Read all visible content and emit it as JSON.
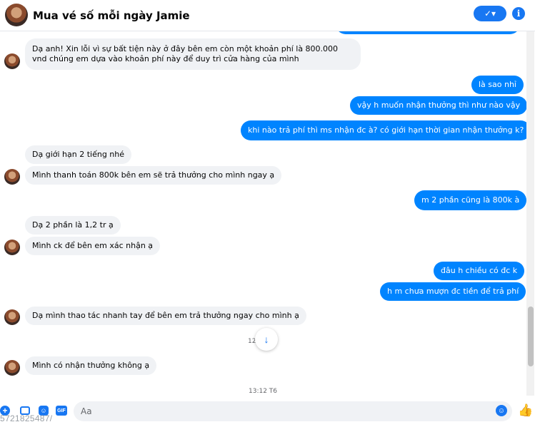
{
  "header": {
    "title": "Mua vé số mỗi ngày Jamie",
    "check_label": "✓▾",
    "info_label": "i"
  },
  "messages": [
    {
      "dir": "in",
      "text": "Dạ anh! Xin lỗi vì sự bất tiện này ở đây bên em còn một khoản phí là 800.000 vnd chúng em dựa vào khoản phí này để duy trì cửa hàng của mình"
    },
    {
      "dir": "out",
      "text": "là sao nhỉ"
    },
    {
      "dir": "out",
      "text": "vậy h muốn nhận thưởng thì như nào vậy"
    },
    {
      "dir": "out",
      "text": "khi nào trả phí thì ms nhận đc à? có giới hạn thời gian nhận thưởng k?"
    },
    {
      "dir": "in",
      "text": "Dạ giới hạn 2 tiếng nhé"
    },
    {
      "dir": "in",
      "text": "Mình thanh toán 800k bên em sẽ trả thưởng cho mình ngay ạ"
    },
    {
      "dir": "out",
      "text": "m 2 phần cũng là 800k à"
    },
    {
      "dir": "in",
      "text": "Dạ 2 phần là 1,2 tr ạ"
    },
    {
      "dir": "in",
      "text": "Mình ck để bên em xác nhận ạ"
    },
    {
      "dir": "out",
      "text": "đâu h chiều có đc k"
    },
    {
      "dir": "out",
      "text": "h m chưa mượn đc tiền để trả phí"
    },
    {
      "dir": "in",
      "text": "Dạ mình thao tác nhanh tay để bên em trả thưởng ngay cho mình ạ"
    },
    {
      "dir": "in",
      "text": "Mình có nhận thưởng không ạ"
    }
  ],
  "timestamps": [
    "12:50 T6",
    "13:12 T6"
  ],
  "composer": {
    "placeholder": "Aa",
    "plus_label": "+",
    "sticker_label": "☺",
    "gif_label": "GIF",
    "emoji_label": "☺",
    "like_label": "👍"
  },
  "scroll_down_label": "↓",
  "overlay_text": "5721825487/",
  "colors": {
    "accent": "#0084ff",
    "incoming_bubble": "#f0f2f5"
  }
}
